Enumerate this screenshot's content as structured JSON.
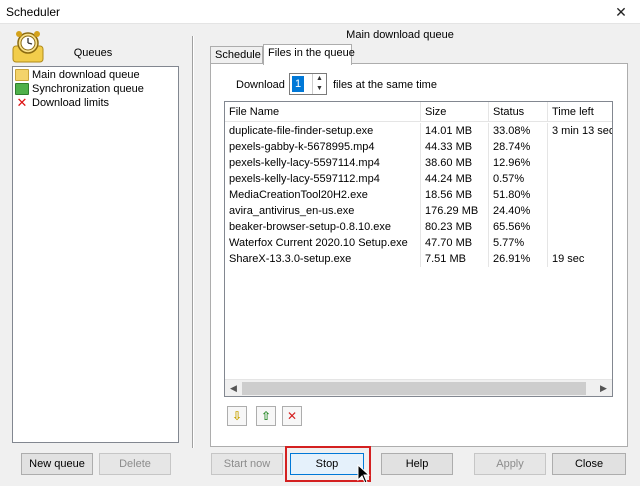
{
  "window": {
    "title": "Scheduler",
    "close_glyph": "✕"
  },
  "left": {
    "queues_label": "Queues",
    "queues": [
      {
        "label": "Main download queue",
        "icon": "yellow-folder-icon"
      },
      {
        "label": "Synchronization queue",
        "icon": "green-sync-folder-icon"
      },
      {
        "label": "Download limits",
        "icon": "red-x-icon"
      }
    ],
    "new_queue": "New queue",
    "delete": "Delete"
  },
  "right": {
    "queue_title": "Main download queue",
    "tabs": [
      "Schedule",
      "Files in the queue"
    ],
    "active_tab": "Files in the queue",
    "download_label": "Download",
    "download_count": "1",
    "files_label": "files at the same time",
    "columns": [
      "File Name",
      "Size",
      "Status",
      "Time left"
    ],
    "rows": [
      [
        "duplicate-file-finder-setup.exe",
        "14.01  MB",
        "33.08%",
        "3 min 13 sec"
      ],
      [
        "pexels-gabby-k-5678995.mp4",
        "44.33  MB",
        "28.74%",
        ""
      ],
      [
        "pexels-kelly-lacy-5597114.mp4",
        "38.60  MB",
        "12.96%",
        ""
      ],
      [
        "pexels-kelly-lacy-5597112.mp4",
        "44.24  MB",
        "0.57%",
        ""
      ],
      [
        "MediaCreationTool20H2.exe",
        "18.56  MB",
        "51.80%",
        ""
      ],
      [
        "avira_antivirus_en-us.exe",
        "176.29  MB",
        "24.40%",
        ""
      ],
      [
        "beaker-browser-setup-0.8.10.exe",
        "80.23  MB",
        "65.56%",
        ""
      ],
      [
        "Waterfox Current 2020.10 Setup.exe",
        "47.70  MB",
        "5.77%",
        ""
      ],
      [
        "ShareX-13.3.0-setup.exe",
        "7.51  MB",
        "26.91%",
        "19 sec"
      ]
    ],
    "tool_buttons": [
      {
        "icon": "move-down-icon",
        "glyph": "⇩",
        "color": "#c9a400"
      },
      {
        "icon": "move-up-icon",
        "glyph": "⇧",
        "color": "#2a8a2a"
      },
      {
        "icon": "remove-icon",
        "glyph": "✕",
        "color": "#d42020"
      }
    ]
  },
  "footer": {
    "start_now": "Start now",
    "stop": "Stop",
    "help": "Help",
    "apply": "Apply",
    "close": "Close"
  },
  "colors": {
    "accent": "#0078d7",
    "highlight": "#d42020"
  }
}
